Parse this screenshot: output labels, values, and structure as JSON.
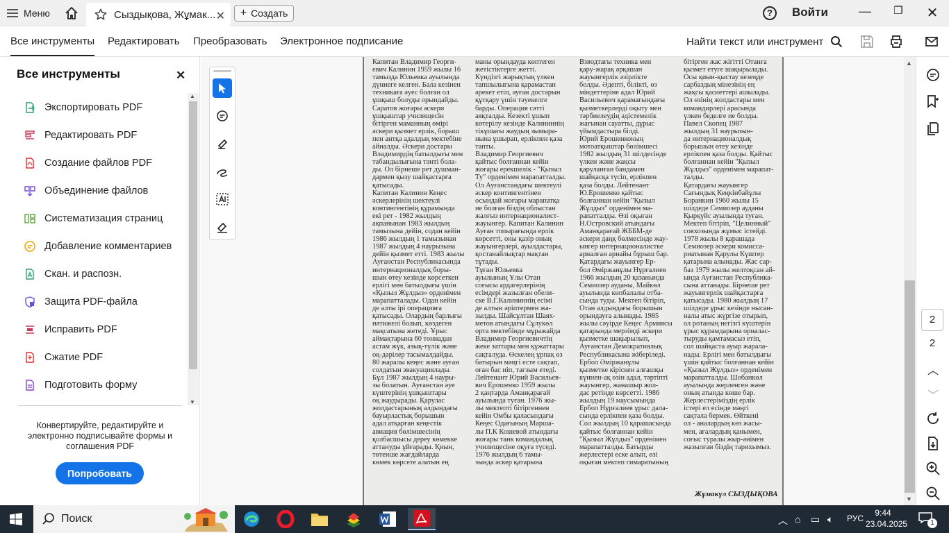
{
  "titlebar": {
    "menu_label": "Меню",
    "tab_title": "Сыздықова, Жұмак...",
    "create_label": "Создать",
    "help": "?",
    "signin": "Войти"
  },
  "toolbar": {
    "items": [
      "Все инструменты",
      "Редактировать",
      "Преобразовать",
      "Электронное подписание"
    ],
    "find_label": "Найти текст или инструмент"
  },
  "sidebar": {
    "title": "Все инструменты",
    "items": [
      {
        "label": "Экспортировать PDF",
        "icon": "export-pdf-icon",
        "color": "#2d9d78"
      },
      {
        "label": "Редактировать PDF",
        "icon": "edit-pdf-icon",
        "color": "#c8365a"
      },
      {
        "label": "Создание файлов PDF",
        "icon": "create-pdf-icon",
        "color": "#e02d2d"
      },
      {
        "label": "Объединение файлов",
        "icon": "combine-files-icon",
        "color": "#7a4de0"
      },
      {
        "label": "Систематизация страниц",
        "icon": "organize-pages-icon",
        "color": "#5aa83c"
      },
      {
        "label": "Добавление комментариев",
        "icon": "comment-icon",
        "color": "#e6a700"
      },
      {
        "label": "Скан. и распозн.",
        "icon": "scan-ocr-icon",
        "color": "#2d9d78"
      },
      {
        "label": "Защита PDF-файла",
        "icon": "protect-pdf-icon",
        "color": "#6a4fe0"
      },
      {
        "label": "Исправить PDF",
        "icon": "redact-pdf-icon",
        "color": "#c8365a"
      },
      {
        "label": "Сжатие PDF",
        "icon": "compress-pdf-icon",
        "color": "#e02d2d"
      },
      {
        "label": "Подготовить форму",
        "icon": "prepare-form-icon",
        "color": "#8a3fc8"
      }
    ],
    "promo_text": "Конвертируйте, редактируйте и электронно подписывайте формы и соглашения PDF",
    "try_button": "Попробовать"
  },
  "document": {
    "col1": "Капитан Владимир Георги-\nевич Калинин 1959 жылы 16\nтамызда Юльевка ауылында\nдүниеге келген. Бала кезінен\nтехникаға әуес болған ол\nұшқыш болуды орындайды.\nСаратов жоғары әскери\nұшқыштар училищесін\nбітірген маманның өмірі\nәскери қызмет ерлік, борыш\nпен антқа адалдық мектебіне\nайналды. Әскери достары\nВладимирдің батылдығы мен\nтабандылығына тәнті бола-\nды. Ол бірнеше рет душман-\nдармен қызу шайқастарға\nқатысады.\n   Капитан Калинин Кеңес\nәскерлерінің шектеулі\nконтингентінің құрамында\nекі рет - 1982 жылдың\nақпанынан 1983 жылдың\nтамызына дейін, содан кейін\n1986 жылдың 1 тамызынан\n1987 жылдың 4 наурызына\nдейін қызмет етті. 1983 жылы\nАуғанстан Республикасында\nинтернационалдық боры-\nшын өтеу кезінде көрсеткен\nерлігі мен батылдығы үшін\n«Қызыл Жұлдыз» орденімен\nмарапатталады. Одан кейін\nде алты ірі операцияға\nқатысады. Олардың барлығы\nнәтижелі болып, көздеген\nмақсатына жетеді. Ұрыс\nаймақтарына 60 тоннадан\nастам жүк, азық-түлік және\nоқ-дәрілер тасымалдайды.\n80 жаралы кеңес және ауған\nсолдатын эвакуациялады.\nБұл 1987 жылдың 4 науры-\nзы болатын. Ауғанстан әуе\nкүштерінің ұшқыштары\nоқ жаудырады. Қарулас\nжолдастарының алдындағы\nбауырластық борышын\nадал атқарған кеңестік\nавиация бөлімшесінің\nқолбасшысы дереу көмекке\nаттануды ұйғарады. Қиын,\nтөтенше жағдайларда\nкөмек көрсете алатын ең",
    "col2": "маны орындауда көптеген\nжетістіктерге жетті.\nКүндізгі жарықтың үлкен\nтапшылығына қарамастан\nәрекет етіп, ауған достарын\nқұтқару үшін тәуекелге\nбарды. Операция сәтті\nаяқталды. Кезекті ұшып\nкөтерілу кезінде Калининнің\nтікұшағы жаудың зымыра-\nнына ұшырап, ерлікпен қаза\nтапты.\n   Владимир Георгиевич\nқайтыс болғаннан кейін\nжоғары ерекшелік - \"Қызыл\nТу\" орденімен марапатталды.\nОл Ауғанстандағы шектеулі\nәскер контингентінен\nосындай жоғары марапатқа\nие болған біздің облыстан\nжалғыз интернационалист-\nжауынгер. Капитан Калинин\nАуған топырағында ерлік\nкөрсетті, оны қазір оның\nжауынгерлері, ауылдастары,\nқостанайлықтар мақтан\nтұтады.\n   Тұған Юльевка\nауылының Ұлы Отан\nсоғысы ардагерлерінің\nесімдері жазылған обели-\nске В.Г.Калининнің есімі\nде алтын әріптермен жа-\nзылды. Шайсұлтан Шаях-\nметов атындағы Сұлукөл\nорта мектебінде мұражайда\nВладимир Георгиевичтің\nжеке заттары мен құжаттары\nсақталуда. Өскелең ұрпақ өз\nбатырын мәңгі есте сақтап,\nоған бас иіп, тағзым етеді.\n   Лейтенант Юрий Васильев-\nвич Ерошенко 1959 жылы\n2 қаңтарда Аманқарағай\nауылында туған. 1976 жы-\nлы мектепті бітіргеннен\nкейін Омбы қаласындағы\nКеңес Одағының Марша-\nлы П.К Кошевой атындағы\nжоғары танк командалық\nучилищесіне оқуға түседі.\n1976 жылдың 6 тамы-\nзында әскер қатарына",
    "col3": "Взводтағы техника мен\nқару-жарақ әрқашан\nжауынгерлік әзірлікте\nболды. Әдепті, білікті, өз\nміндеттеріне адал Юрий\nВасильевич қарамағындағы\nқызметкерлерді оқыту мен\nтәрбиелеудің әдістемелік\nжағынан сауатты, дұрыс\nүйымдастыра білді.\n   Юрий Ерошенконың\nмотоатқыштар бөлімшесі\n1982 жылдың 31 шілдесінде\nүлкен және жақсы\nқаруланған бандамен\nшайқасқа түсіп, ерлікпен\nқаза болды. Лейтенант\nЮ.Ерошенко қайтыс\nболғаннан кейін \"Қызыл\nЖұлдыз\" орденімен ма-\nрапатталды. Өзі оқыған\nН.Островский атындағы\nАманқарағай ЖББМ-де\nәскери даңқ бөлмесінде жау-\nынгер интернационалистке\nарналған арнайы бұрыш бар.\n   Қатардағы жауынгер Ер-\nбол Әміржанұлы Нұрғалиев\n1966 жылдың 20 қазанында\nСемиозер ауданы, Майкөл\nауылында көпбалалы отба-\nсында туды. Мектеп бітіріп,\nОтан алдындағы борышын\nорындауға алынады. 1985\nжылы сәуірде Кеңес Армиясы\nқатарында мерзімді әскери\nқызметке шақырылып,\nАуғанстан Демократиялық\nРеспубликасына жіберіледі.\n   Ербол Әміржанұлы\nқызметке кіріскен алғашқы\nкүннен-ақ өзін адал, тәртіпті\nжауынгер, жанашыр жол-\nдас ретінде көрсетті. 1986\nжылдың 19 маусымында\nЕрбол Нұрғалиев ұрыс дала-\nсында ерлікпен қаза болды.\nСол жылдың 10 қарашасында\nқайтыс болғаннан кейін\n\"Қызыл Жұлдыз\" орденімен\nмарапатталды. Батырды\nжерлестері еске алып, өзі\nоқыған мектеп гимаратының",
    "col4": "бітірген жас жігітті Отанға\nқызмет етуге шақырылады.\nОсы қиын-қыстау кезеңде\nсарбаздың мінезінің ең\nжақсы қасиеттері ашылады.\nОл өзінің жолдастары мен\nкомандирлері арасында\nүлкен беделге ие болды.\n   Павел Скопец 1987\nжылдың 31 наурызын-\nда интернационалдық\nборышын өтеу кезінде\nерлікпен қаза болды. Қайтыс\nболғаннан кейін \"Қызыл\nЖұлдыз\" орденімен марапат-\nталды.\n   Қатардағы жауынгер\nСағындық Кеңкінбайұлы\nБоранкин 1960 жылы 15\nшілдеде Семиозер ауданы\nҚырқүйс ауылында туған.\nМектеп бітіріп, \"Целинный\"\nсовхозында жұмыс істейді.\n1978 жылы 8 қарашада\nСемиозер әскери комисса-\nриатынан Қарулы Күштер\nқатарына алынады. Жас сар-\nбаз 1979 жылы желтоқсан ай-\nында Ауғанстан Республика-\nсына аттанады. Бірнеше рет\nжауынгерлік шайқастарға\nқатысады. 1980 жылдың 17\nшілдеде ұрыс кезінде нысан-\nналы атыс жүргізе отырып,\nол ротаның негізгі күштерін\nұрыс құрамдарына орналас-\nтыруды қамтамасыз етіп,\nсол шайқаста ауыр жарала-\nнады. Ерлігі мен батылдығы\nүшін қайтыс болғаннан кейін\n«Қызыл Жұлдыз» орденімен\nмарапатталды. Шобанкөл\nауылында жерленген және\nоның атында көше бар.\n   Жерлестеріміздің ерлік\nістері ел есінде мәңгі\nсақтала бермек. Өйткені\nол - аналардың көз жасы-\nмен, ағалардың қанымен,\nсоғыс туралы жыр-әнімен\nжазылған біздің тарихымыз.",
    "signature": "Жұмакүл СЫЗДЫҚОВА"
  },
  "pager": {
    "current": "2",
    "total": "2"
  },
  "taskbar": {
    "search_label": "Поиск",
    "language": "РУС",
    "time": "9:44",
    "date": "23.04.2025",
    "notification_count": "1"
  },
  "colors": {
    "accent": "#1473e6",
    "taskbar": "#1f2a35"
  }
}
